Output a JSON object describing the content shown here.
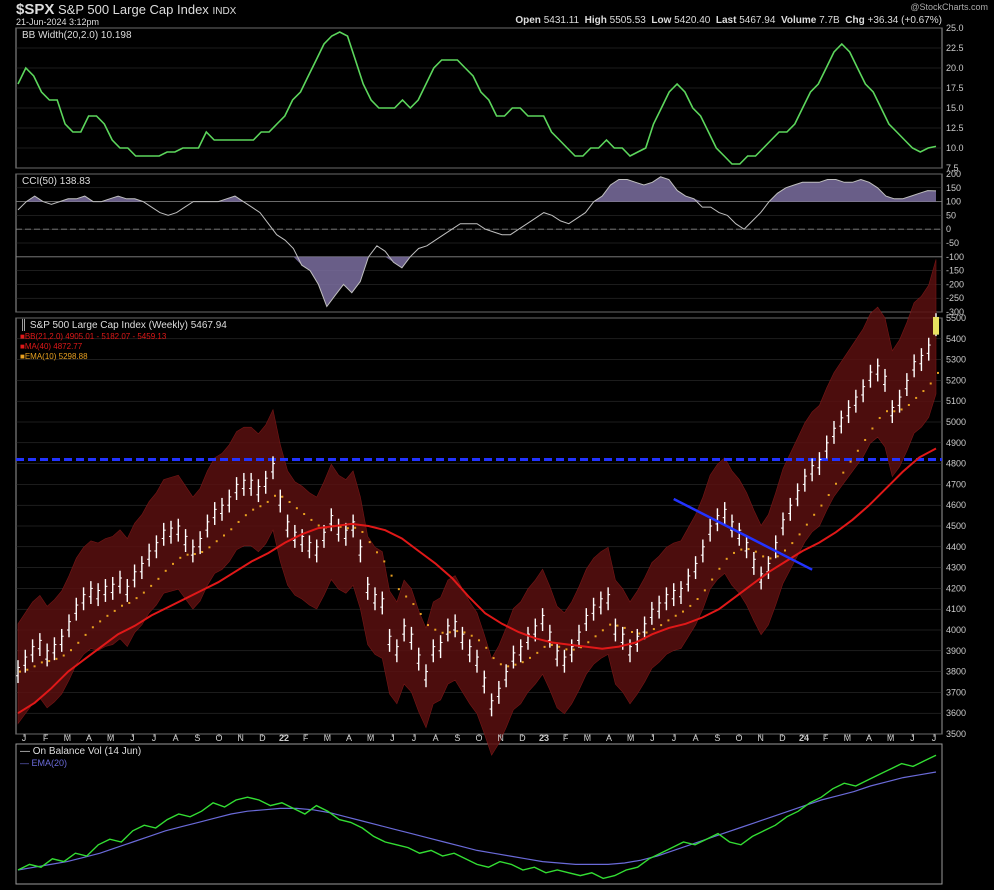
{
  "header": {
    "symbol": "$SPX",
    "name": "S&P 500 Large Cap Index",
    "exchange": "INDX",
    "datetime": "21-Jun-2024 3:12pm",
    "watermark": "@StockCharts.com",
    "open_label": "Open",
    "open": "5431.11",
    "high_label": "High",
    "high": "5505.53",
    "low_label": "Low",
    "low": "5420.40",
    "last_label": "Last",
    "last": "5467.94",
    "volume_label": "Volume",
    "volume": "7.7B",
    "chg_label": "Chg",
    "chg": "+36.34 (+0.67%)"
  },
  "colors": {
    "bg": "#000000",
    "grid": "#3a3a3a",
    "frame": "#9a9a9a",
    "bbw_line": "#5cd65c",
    "cci_line": "#bfbfbf",
    "cci_fill": "#7b6fa0",
    "price_bar": "#ffffff",
    "band_fill": "#5a1010",
    "band_line": "#8b1a1a",
    "ma_line": "#e01818",
    "ema_dots": "#e8a020",
    "hline": "#2233ff",
    "trend": "#2233ff",
    "obv_line": "#33dd33",
    "obv_ema": "#6a6ad8",
    "last_mark": "#e8e060"
  },
  "chart_data": [
    {
      "type": "line",
      "title": "BB Width(20,2.0) 10.198",
      "ylim": [
        7.5,
        25
      ],
      "yticks": [
        "25.0",
        "22.5",
        "20.0",
        "17.5",
        "15.0",
        "12.5",
        "10.0",
        "7.5"
      ],
      "series": [
        {
          "name": "BB Width(20,2.0)",
          "values": [
            18,
            20,
            19,
            17,
            16,
            16,
            13,
            12,
            12,
            14,
            14,
            13,
            11,
            10,
            10,
            9,
            9,
            9,
            9,
            9.5,
            9.5,
            10,
            10,
            10,
            12,
            11,
            11,
            11,
            11,
            11,
            11,
            12,
            12,
            13,
            14,
            16,
            17,
            19,
            21,
            23,
            24,
            24.5,
            24,
            21,
            18,
            16,
            15,
            15,
            15,
            16,
            15,
            16,
            18,
            20,
            21,
            21,
            21,
            20,
            19,
            17,
            16,
            14,
            14,
            15,
            15,
            14,
            14,
            14,
            12,
            11,
            10,
            9,
            9,
            10,
            10,
            11,
            10,
            10,
            9,
            9.5,
            10,
            13,
            15,
            17,
            18,
            17,
            15,
            14,
            12,
            10,
            9,
            8,
            8,
            9,
            9,
            10,
            11,
            12,
            12,
            13,
            15,
            17,
            18,
            20,
            22,
            23,
            22,
            20,
            18,
            17,
            15,
            13,
            12,
            11,
            10,
            9.5,
            10,
            10.2
          ]
        }
      ]
    },
    {
      "type": "area",
      "title": "CCI(50) 138.83",
      "ylim": [
        -300,
        200
      ],
      "yticks": [
        "200",
        "150",
        "100",
        "50",
        "0",
        "-50",
        "-100",
        "-150",
        "-200",
        "-250",
        "-300"
      ],
      "series": [
        {
          "name": "CCI(50)",
          "values": [
            70,
            100,
            120,
            100,
            90,
            100,
            110,
            110,
            120,
            100,
            100,
            110,
            120,
            110,
            110,
            100,
            80,
            60,
            50,
            60,
            80,
            100,
            100,
            100,
            100,
            110,
            120,
            100,
            80,
            60,
            20,
            -20,
            -40,
            -70,
            -130,
            -150,
            -200,
            -280,
            -240,
            -200,
            -230,
            -190,
            -100,
            -60,
            -80,
            -120,
            -140,
            -100,
            -70,
            -60,
            -40,
            -20,
            0,
            20,
            20,
            20,
            0,
            -10,
            -20,
            -20,
            0,
            20,
            40,
            60,
            50,
            30,
            20,
            40,
            60,
            100,
            120,
            160,
            180,
            180,
            170,
            160,
            170,
            190,
            180,
            140,
            120,
            110,
            80,
            80,
            60,
            50,
            20,
            0,
            30,
            60,
            100,
            130,
            150,
            160,
            170,
            170,
            170,
            180,
            180,
            170,
            170,
            180,
            170,
            150,
            120,
            110,
            110,
            120,
            130,
            140,
            138.83
          ]
        }
      ]
    },
    {
      "type": "line",
      "title": "S&P 500 Large Cap Index (Weekly) 5467.94",
      "legend": [
        "BB(21,2.0) 4905.01 - 5182.07 - 5459.13",
        "MA(40) 4872.77",
        "EMA(10) 5298.88"
      ],
      "ylim": [
        3500,
        5500
      ],
      "yticks": [
        "5500",
        "5400",
        "5300",
        "5200",
        "5100",
        "5000",
        "4900",
        "4800",
        "4700",
        "4600",
        "4500",
        "4400",
        "4300",
        "4200",
        "4100",
        "4000",
        "3900",
        "3800",
        "3700",
        "3600",
        "3500"
      ],
      "xticks": [
        "J",
        "F",
        "M",
        "A",
        "M",
        "J",
        "J",
        "A",
        "S",
        "O",
        "N",
        "D",
        "22",
        "F",
        "M",
        "A",
        "M",
        "J",
        "J",
        "A",
        "S",
        "O",
        "N",
        "D",
        "23",
        "F",
        "M",
        "A",
        "M",
        "J",
        "J",
        "A",
        "S",
        "O",
        "N",
        "D",
        "24",
        "F",
        "M",
        "A",
        "M",
        "J",
        "J"
      ],
      "horizontal_line": 4820,
      "series": [
        {
          "name": "S&P 500 Large Cap Index (Weekly)",
          "values": [
            3800,
            3850,
            3900,
            3930,
            3880,
            3910,
            3950,
            4020,
            4100,
            4150,
            4180,
            4170,
            4190,
            4200,
            4230,
            4190,
            4260,
            4300,
            4360,
            4400,
            4460,
            4470,
            4480,
            4430,
            4380,
            4420,
            4500,
            4560,
            4580,
            4620,
            4680,
            4700,
            4700,
            4670,
            4710,
            4780,
            4620,
            4500,
            4450,
            4430,
            4400,
            4380,
            4450,
            4530,
            4480,
            4460,
            4500,
            4380,
            4200,
            4150,
            4130,
            3950,
            3900,
            4000,
            3960,
            3860,
            3780,
            3900,
            3920,
            4000,
            4020,
            3960,
            3900,
            3850,
            3750,
            3640,
            3700,
            3780,
            3870,
            3900,
            3960,
            4000,
            4050,
            3970,
            3880,
            3850,
            3900,
            3970,
            4050,
            4100,
            4130,
            4150,
            4000,
            3960,
            3900,
            3950,
            4010,
            4080,
            4110,
            4150,
            4170,
            4180,
            4240,
            4300,
            4380,
            4480,
            4530,
            4560,
            4500,
            4460,
            4400,
            4320,
            4250,
            4300,
            4400,
            4510,
            4580,
            4650,
            4720,
            4770,
            4800,
            4880,
            4950,
            5000,
            5050,
            5100,
            5150,
            5220,
            5250,
            5200,
            5050,
            5100,
            5180,
            5270,
            5300,
            5350,
            5467.94
          ]
        },
        {
          "name": "MA(40)",
          "values": [
            3600,
            3650,
            3720,
            3800,
            3860,
            3920,
            3980,
            4020,
            4070,
            4110,
            4150,
            4190,
            4230,
            4280,
            4330,
            4370,
            4420,
            4460,
            4490,
            4500,
            4510,
            4500,
            4480,
            4440,
            4380,
            4320,
            4250,
            4160,
            4080,
            4030,
            3990,
            3960,
            3940,
            3930,
            3920,
            3910,
            3920,
            3940,
            3980,
            4010,
            4030,
            4060,
            4100,
            4160,
            4220,
            4280,
            4330,
            4380,
            4420,
            4470,
            4530,
            4600,
            4680,
            4760,
            4830,
            4872.77
          ]
        },
        {
          "name": "EMA(10)",
          "values": [
            5298.88
          ]
        }
      ]
    },
    {
      "type": "line",
      "title": "On Balance Vol (14 Jun)",
      "series": [
        {
          "name": "On Balance Vol (14 Jun)",
          "values": [
            10,
            14,
            12,
            18,
            16,
            22,
            20,
            28,
            32,
            30,
            38,
            42,
            40,
            46,
            50,
            48,
            52,
            58,
            55,
            60,
            62,
            60,
            56,
            58,
            54,
            50,
            56,
            52,
            46,
            44,
            40,
            34,
            30,
            28,
            26,
            22,
            24,
            20,
            22,
            18,
            14,
            12,
            16,
            14,
            10,
            12,
            8,
            10,
            8,
            6,
            8,
            4,
            6,
            10,
            12,
            18,
            22,
            26,
            30,
            28,
            32,
            36,
            30,
            28,
            34,
            38,
            42,
            48,
            52,
            58,
            62,
            68,
            72,
            70,
            74,
            78,
            82,
            86,
            84,
            88,
            92
          ]
        },
        {
          "name": "EMA(20)",
          "values": [
            10,
            12,
            14,
            16,
            19,
            22,
            26,
            30,
            34,
            38,
            41,
            44,
            47,
            50,
            52,
            53,
            54,
            54,
            53,
            51,
            48,
            45,
            42,
            39,
            36,
            33,
            30,
            27,
            24,
            22,
            20,
            18,
            16,
            15,
            14,
            14,
            14,
            15,
            17,
            20,
            24,
            28,
            32,
            36,
            40,
            44,
            48,
            52,
            56,
            60,
            63,
            66,
            70,
            73,
            76,
            78,
            80
          ]
        }
      ]
    }
  ]
}
